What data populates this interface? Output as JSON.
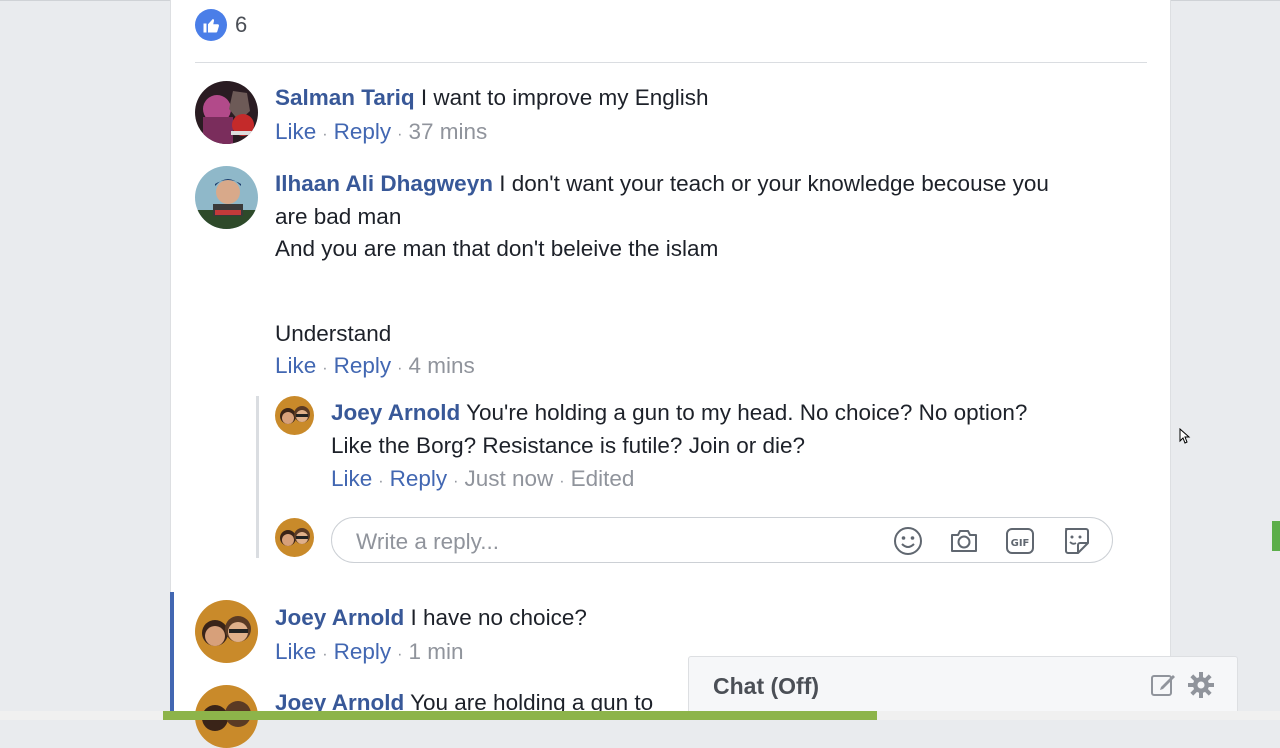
{
  "post": {
    "like_count": "6"
  },
  "comments": [
    {
      "author": "Salman Tariq",
      "text": "I want to improve my English",
      "like": "Like",
      "reply": "Reply",
      "time": "37 mins"
    },
    {
      "author": "Ilhaan Ali Dhagweyn",
      "text_line1": "I don't want your teach or your knowledge becouse you",
      "text_line2": "are bad man",
      "text_line3": "And you are man that don't beleive the islam",
      "text_line4": "Understand",
      "like": "Like",
      "reply": "Reply",
      "time": "4 mins",
      "replies": [
        {
          "author": "Joey Arnold",
          "text_line1": "You're holding a gun to my head. No choice? No option?",
          "text_line2": "Like the Borg? Resistance is futile? Join or die?",
          "like": "Like",
          "reply": "Reply",
          "time": "Just now",
          "edited": "Edited"
        }
      ]
    },
    {
      "author": "Joey Arnold",
      "text": "I have no choice?",
      "like": "Like",
      "reply": "Reply",
      "time": "1 min"
    },
    {
      "author": "Joey Arnold",
      "text": "You are holding a gun to"
    }
  ],
  "reply_box": {
    "placeholder": "Write a reply...",
    "icons": [
      "emoji-icon",
      "camera-icon",
      "gif-icon",
      "sticker-icon"
    ]
  },
  "chat": {
    "title": "Chat (Off)",
    "icons": [
      "compose-icon",
      "gear-icon"
    ]
  },
  "colors": {
    "link": "#385898",
    "action": "#4267b2",
    "meta": "#90949c",
    "like_badge": "#4a7ee8",
    "focus_bar": "#4267b2"
  }
}
